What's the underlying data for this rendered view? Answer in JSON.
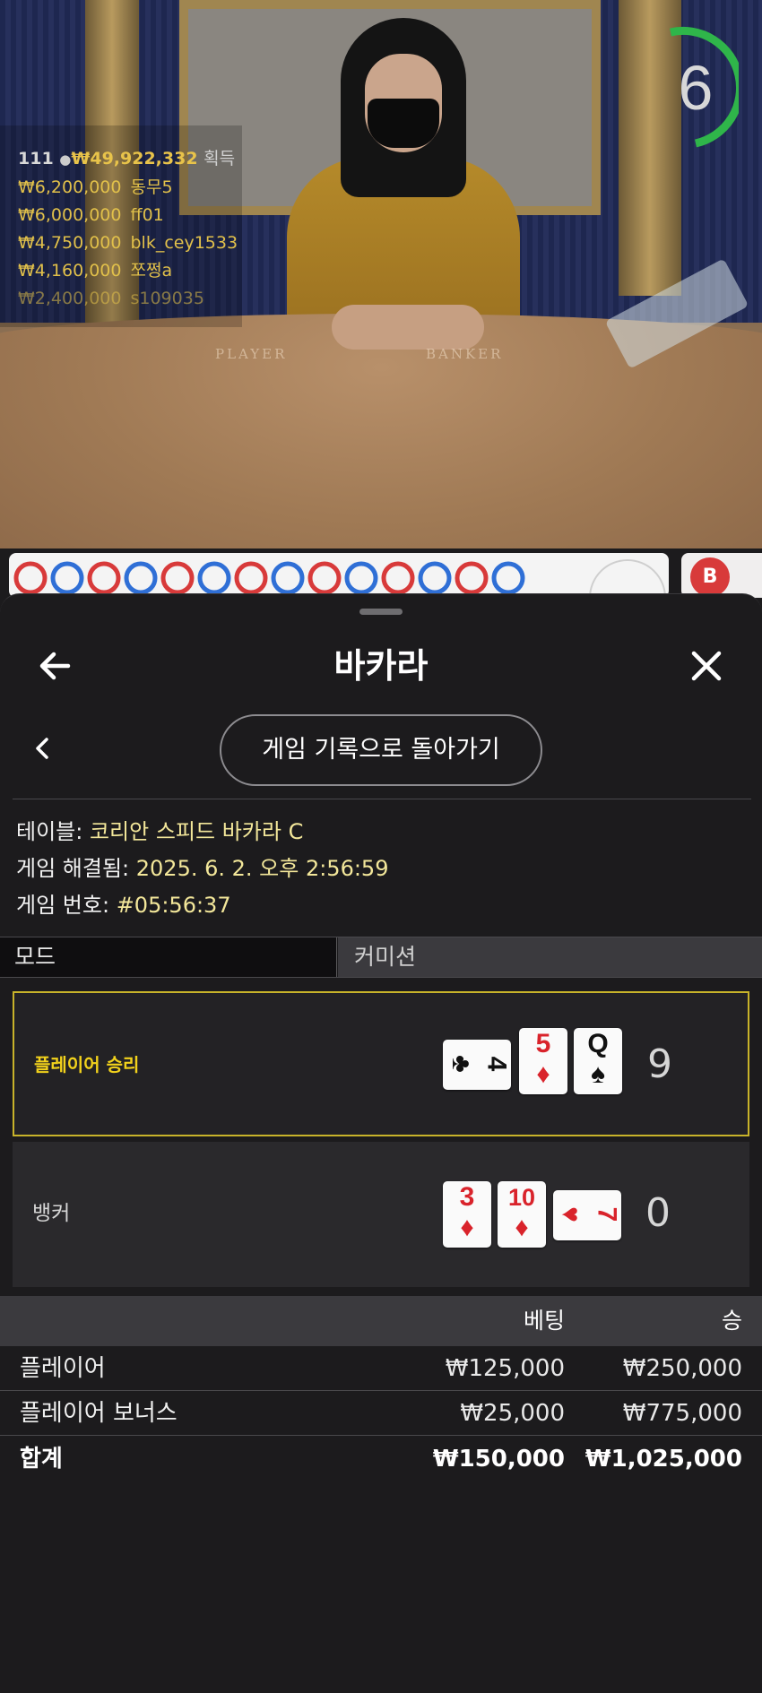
{
  "video": {
    "timer": "6",
    "felt_player": "PLAYER",
    "felt_banker": "BANKER",
    "winners_header": {
      "count": "111",
      "total": "₩49,922,332",
      "suffix": "획득"
    },
    "winners": [
      {
        "amount": "₩6,200,000",
        "name": "동무5"
      },
      {
        "amount": "₩6,000,000",
        "name": "ff01"
      },
      {
        "amount": "₩4,750,000",
        "name": "blk_cey1533"
      },
      {
        "amount": "₩4,160,000",
        "name": "쪼쩡a"
      },
      {
        "amount": "₩2,400,000",
        "name": "s109035"
      }
    ]
  },
  "road": {
    "results": [
      "R",
      "B",
      "R",
      "B",
      "R",
      "B",
      "R",
      "B",
      "R",
      "B",
      "R",
      "B",
      "R",
      "B"
    ],
    "side_badge": "B",
    "colors": {
      "player": "#2f6fd6",
      "banker": "#d83a3a",
      "tie": "#2aa04a"
    }
  },
  "sheet": {
    "title": "바카라",
    "return_button": "게임 기록으로 돌아가기",
    "table_label": "테이블:",
    "table_value": "코리안 스피드 바카라 C",
    "resolved_label": "게임 해결됨:",
    "resolved_value": "2025. 6. 2. 오후 2:56:59",
    "game_no_label": "게임 번호:",
    "game_no_value": "#05:56:37",
    "mode_tab": "모드",
    "commission_tab": "커미션",
    "player_hand": {
      "label": "플레이어 승리",
      "score": "9",
      "cards": [
        {
          "rank": "4",
          "suit": "♣"
        },
        {
          "rank": "5",
          "suit": "♦"
        },
        {
          "rank": "Q",
          "suit": "♠"
        }
      ]
    },
    "banker_hand": {
      "label": "뱅커",
      "score": "0",
      "cards": [
        {
          "rank": "3",
          "suit": "♦"
        },
        {
          "rank": "10",
          "suit": "♦"
        },
        {
          "rank": "7",
          "suit": "♥"
        }
      ]
    },
    "bets_header": {
      "bet": "베팅",
      "win": "승"
    },
    "bets": [
      {
        "name": "플레이어",
        "bet": "₩125,000",
        "win": "₩250,000"
      },
      {
        "name": "플레이어 보너스",
        "bet": "₩25,000",
        "win": "₩775,000"
      }
    ],
    "total": {
      "name": "합계",
      "bet": "₩150,000",
      "win": "₩1,025,000"
    }
  }
}
